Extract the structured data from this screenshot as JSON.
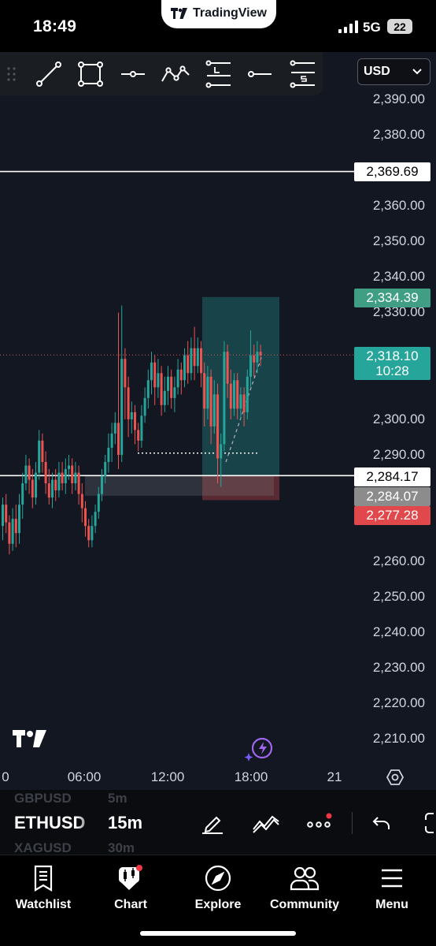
{
  "status_bar": {
    "time": "18:49",
    "app_name": "TradingView",
    "network": "5G",
    "battery": "22"
  },
  "toolbar": {
    "tools": [
      "drag-handle-icon",
      "trend-line-icon",
      "rectangle-icon",
      "horizontal-ray-icon",
      "path-icon",
      "long-position-icon",
      "horizontal-line-icon",
      "short-position-icon"
    ]
  },
  "currency_select": {
    "value": "USD"
  },
  "price_axis": {
    "ticks": [
      "2,390.00",
      "2,380.00",
      "2,360.00",
      "2,350.00",
      "2,340.00",
      "2,330.00",
      "2,300.00",
      "2,290.00",
      "2,260.00",
      "2,250.00",
      "2,240.00",
      "2,230.00",
      "2,220.00",
      "2,210.00"
    ]
  },
  "price_tags": {
    "resistance": "2,369.69",
    "take_profit": "2,334.39",
    "last_price": "2,318.10",
    "countdown": "10:28",
    "support": "2,284.17",
    "entry": "2,284.07",
    "stop_loss": "2,277.28"
  },
  "time_axis": {
    "labels": [
      "0",
      "06:00",
      "12:00",
      "18:00",
      "21"
    ]
  },
  "chart_data": {
    "type": "candlestick",
    "symbol": "ETHUSD",
    "interval": "15m",
    "currency": "USD",
    "ylim": [
      2205,
      2395
    ],
    "horizontal_lines": [
      2369.69,
      2284.17
    ],
    "last_price": 2318.1,
    "position": {
      "side": "long",
      "entry": 2284.07,
      "take_profit": 2334.39,
      "stop_loss": 2277.28
    },
    "colors": {
      "up": "#26a69a",
      "down": "#ef5350",
      "background": "#131722"
    }
  },
  "symbol_bar": {
    "symbol_prev": "GBPUSD",
    "symbol": "ETHUSD",
    "symbol_next": "XAGUSD",
    "tf_prev": "5m",
    "timeframe": "15m",
    "tf_next": "30m"
  },
  "bottom_nav": {
    "items": [
      {
        "label": "Watchlist",
        "icon": "watchlist-icon"
      },
      {
        "label": "Chart",
        "icon": "chart-icon"
      },
      {
        "label": "Explore",
        "icon": "compass-icon"
      },
      {
        "label": "Community",
        "icon": "community-icon"
      },
      {
        "label": "Menu",
        "icon": "menu-icon"
      }
    ]
  }
}
